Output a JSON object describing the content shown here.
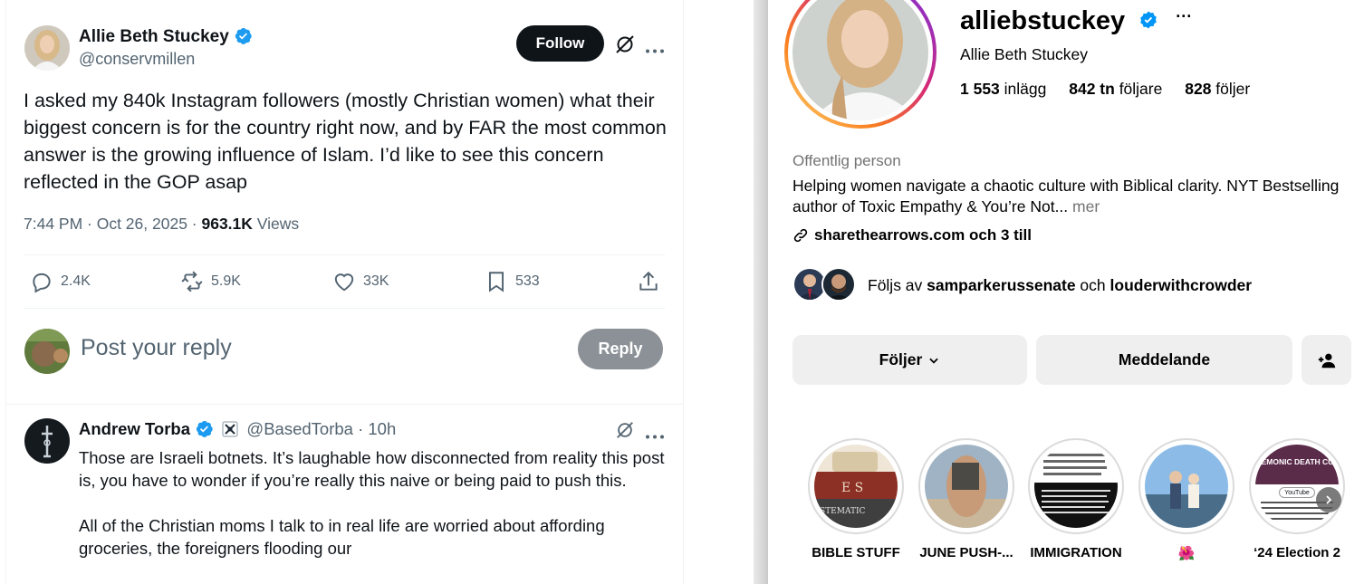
{
  "colors": {
    "x_text": "#0f1419",
    "x_muted": "#536471",
    "x_verified": "#1d9bf0",
    "ig_verified": "#0095f6",
    "ig_button_bg": "#efefef"
  },
  "tweet": {
    "author_name": "Allie Beth Stuckey",
    "author_handle": "@conservmillen",
    "follow_label": "Follow",
    "text": "I asked my 840k Instagram followers (mostly Christian women) what their biggest concern is for the country right now, and by FAR the most common answer is the growing influence of Islam. I’d like to see this concern reflected in the GOP asap",
    "time": "7:44 PM · Oct 26, 2025 · ",
    "views_count": "963.1K",
    "views_label": " Views",
    "actions": {
      "replies": "2.4K",
      "reposts": "5.9K",
      "likes": "33K",
      "bookmarks": "533"
    },
    "reply_placeholder": "Post your reply",
    "reply_button": "Reply"
  },
  "reply": {
    "author_name": "Andrew Torba",
    "author_handle": "@BasedTorba",
    "separator": " · ",
    "age": "10h",
    "paragraph1": "Those are Israeli botnets. It’s laughable how disconnected from reality this post is, you have to wonder if you’re really this naive or being paid to push this.",
    "paragraph2": "All of the Christian moms I talk to in real life are worried about affording groceries, the foreigners flooding our"
  },
  "instagram": {
    "username": "alliebstuckey",
    "more_label": "···",
    "full_name": "Allie Beth Stuckey",
    "stats": {
      "posts_count": "1 553",
      "posts_label": " inlägg",
      "followers_count": "842 tn",
      "followers_label": " följare",
      "following_count": "828",
      "following_label": " följer"
    },
    "category": "Offentlig person",
    "bio": "Helping women navigate a chaotic culture with Biblical clarity. NYT Bestselling author of Toxic Empathy & You’re Not...",
    "bio_more": " mer",
    "link": "sharethearrows.com och 3 till",
    "followed_by_prefix": "Följs av ",
    "followed_by_user1": "samparkerussenate",
    "followed_by_joiner": " och ",
    "followed_by_user2": "louderwithcrowder",
    "buttons": {
      "following": "Följer",
      "message": "Meddelande"
    },
    "highlights": [
      {
        "label": "BIBLE STUFF"
      },
      {
        "label": "JUNE PUSH-..."
      },
      {
        "label": "IMMIGRATION"
      },
      {
        "label": "🌺"
      },
      {
        "label": "‘24 Election 2"
      }
    ],
    "highlight5_banner": "DEMONIC DEATH CUL",
    "highlight5_tag": "YouTube"
  }
}
